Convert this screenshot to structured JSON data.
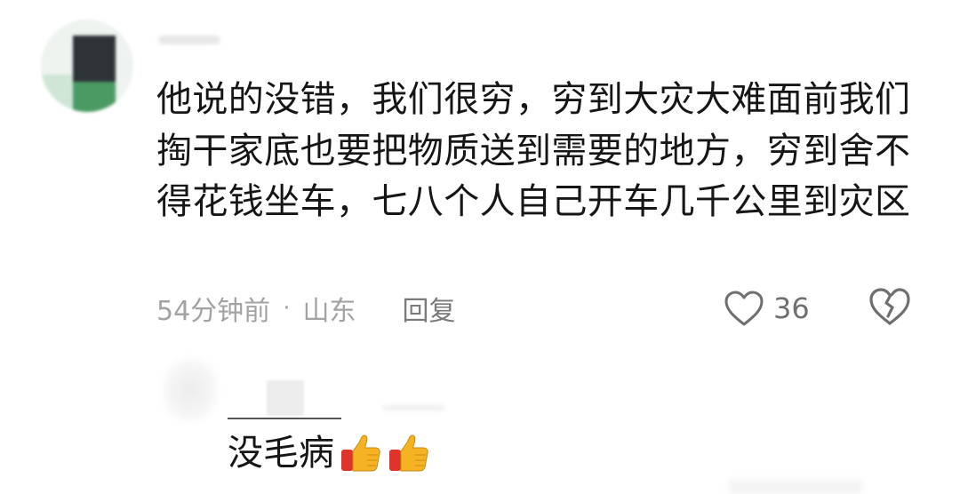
{
  "comment": {
    "text": "他说的没错，我们很穷，穷到大灾大难面前我们掏干家底也要把物质送到需要的地方，穷到舍不得花钱坐车，七八个人自己开车几千公里到灾区",
    "time": "54分钟前",
    "separator": "·",
    "location": "山东",
    "reply_label": "回复",
    "like_count": "36",
    "icons": {
      "like": "heart-outline-icon",
      "dislike": "broken-heart-icon"
    }
  },
  "reply": {
    "text": "没毛病",
    "emojis": [
      "thumbs-up-icon",
      "thumbs-up-icon"
    ]
  },
  "colors": {
    "text": "#161616",
    "meta": "#a3a3a3",
    "icon": "#6f6f6f",
    "emoji_hand": "#f5b324",
    "emoji_cuff": "#e0342a"
  }
}
